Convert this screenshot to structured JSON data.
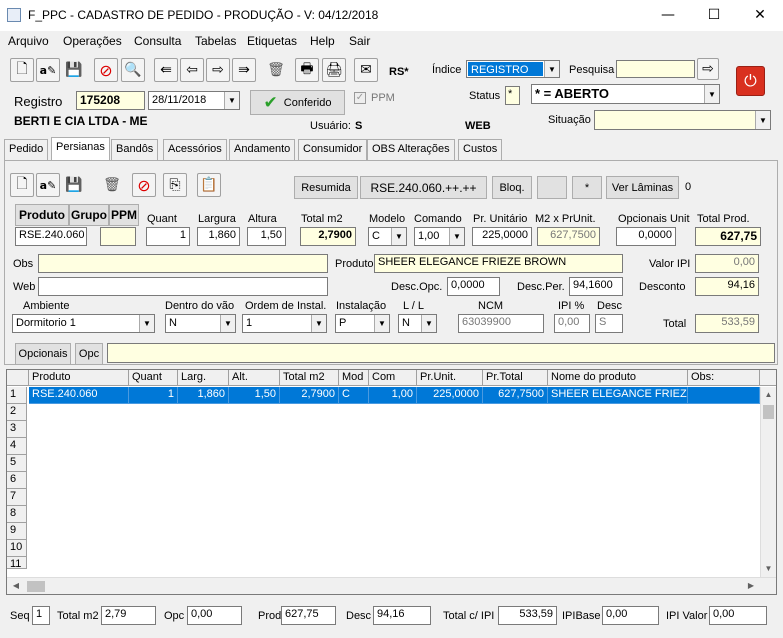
{
  "window": {
    "title": "F_PPC - CADASTRO DE PEDIDO - PRODUÇÃO - V: 04/12/2018",
    "minimize": "—",
    "maximize": "☐",
    "close": "✕"
  },
  "menu": [
    "Arquivo",
    "Operações",
    "Consulta",
    "Tabelas",
    "Etiquetas",
    "Help",
    "Sair"
  ],
  "header": {
    "rs_label": "RS*",
    "indice_label": "Índice",
    "indice_value": "REGISTRO",
    "pesquisa_label": "Pesquisa",
    "pesquisa_value": "",
    "registro_label": "Registro",
    "registro_value": "175208",
    "date_value": "28/11/2018",
    "conferido_label": "Conferido",
    "ppm_label": "PPM",
    "status_label": "Status",
    "status_code": "*",
    "status_value": "* = ABERTO",
    "client": "BERTI E CIA LTDA - ME",
    "usuario_label": "Usuário:",
    "usuario_value": "S",
    "web_label": "WEB",
    "situacao_label": "Situação",
    "situacao_value": ""
  },
  "tabs": [
    "Pedido",
    "Persianas",
    "Bandôs",
    "Acessórios",
    "Andamento",
    "Consumidor",
    "OBS Alterações",
    "Custos"
  ],
  "panel": {
    "resumida_label": "Resumida",
    "code_display": "RSE.240.060.++.++",
    "bloq_label": "Bloq.",
    "blank_btn": "",
    "star_btn": "*",
    "ver_laminas_label": "Ver Lâminas",
    "ver_laminas_count": "0",
    "produto_btn": "Produto",
    "grupo_btn": "Grupo",
    "ppm_btn": "PPM",
    "quant_label": "Quant",
    "largura_label": "Largura",
    "altura_label": "Altura",
    "total_m2_label": "Total m2",
    "modelo_label": "Modelo",
    "comando_label": "Comando",
    "pr_unit_label": "Pr. Unitário",
    "m2_pr_unit_label": "M2 x PrUnit.",
    "opc_unit_label": "Opcionais Unit",
    "total_prod_label": "Total Prod.",
    "produto_code": "RSE.240.060",
    "grupo_value": "",
    "quant": "1",
    "largura": "1,860",
    "altura": "1,50",
    "total_m2": "2,7900",
    "modelo": "C",
    "comando": "1,00",
    "pr_unit": "225,0000",
    "m2_pr_unit": "627,7500",
    "opc_unit": "0,0000",
    "total_prod": "627,75",
    "obs_label": "Obs",
    "obs_value": "",
    "produto_label": "Produto",
    "produto_name": "SHEER ELEGANCE FRIEZE BROWN",
    "valor_ipi_label": "Valor IPI",
    "valor_ipi": "0,00",
    "web_label": "Web",
    "web_value": "",
    "desc_opc_label": "Desc.Opc.",
    "desc_opc": "0,0000",
    "desc_per_label": "Desc.Per.",
    "desc_per": "94,1600",
    "desconto_label": "Desconto",
    "desconto": "94,16",
    "ambiente_label": "Ambiente",
    "ambiente": "Dormitorio 1",
    "dentro_label": "Dentro do vão",
    "dentro": "N",
    "ordem_label": "Ordem de Instal.",
    "ordem": "1",
    "instalacao_label": "Instalação",
    "instalacao": "P",
    "ll_label": "L / L",
    "ll": "N",
    "ncm_label": "NCM",
    "ncm": "63039900",
    "ipi_label": "IPI %",
    "ipi": "0,00",
    "desc_label": "Desc",
    "desc": "S",
    "total_label": "Total",
    "total": "533,59",
    "opcionais_btn": "Opcionais",
    "opc_btn": "Opc",
    "opc_value": ""
  },
  "grid": {
    "headers": [
      "Produto",
      "Quant",
      "Larg.",
      "Alt.",
      "Total m2",
      "Mod",
      "Com",
      "Pr.Unit.",
      "Pr.Total",
      "Nome do produto",
      "Obs:"
    ],
    "row": [
      "RSE.240.060",
      "1",
      "1,860",
      "1,50",
      "2,7900",
      "C",
      "1,00",
      "225,0000",
      "627,7500",
      "SHEER ELEGANCE FRIEZE",
      ""
    ],
    "row_numbers": [
      "1",
      "2",
      "3",
      "4",
      "5",
      "6",
      "7",
      "8",
      "9",
      "10",
      "11"
    ]
  },
  "footer": {
    "seq_label": "Seq",
    "seq": "1",
    "total_m2_label": "Total m2",
    "total_m2": "2,79",
    "opc_label": "Opc",
    "opc": "0,00",
    "prod_label": "Prod",
    "prod": "627,75",
    "desc_label": "Desc",
    "desc": "94,16",
    "total_ipi_label": "Total c/ IPI",
    "total_ipi": "533,59",
    "ipibase_label": "IPIBase",
    "ipibase": "0,00",
    "ipi_valor_label": "IPI Valor",
    "ipi_valor": "0,00"
  },
  "colors": {
    "selection": "#0078d7",
    "readonly_yellow": "#ffffe1",
    "close_button": "#d9301f"
  }
}
